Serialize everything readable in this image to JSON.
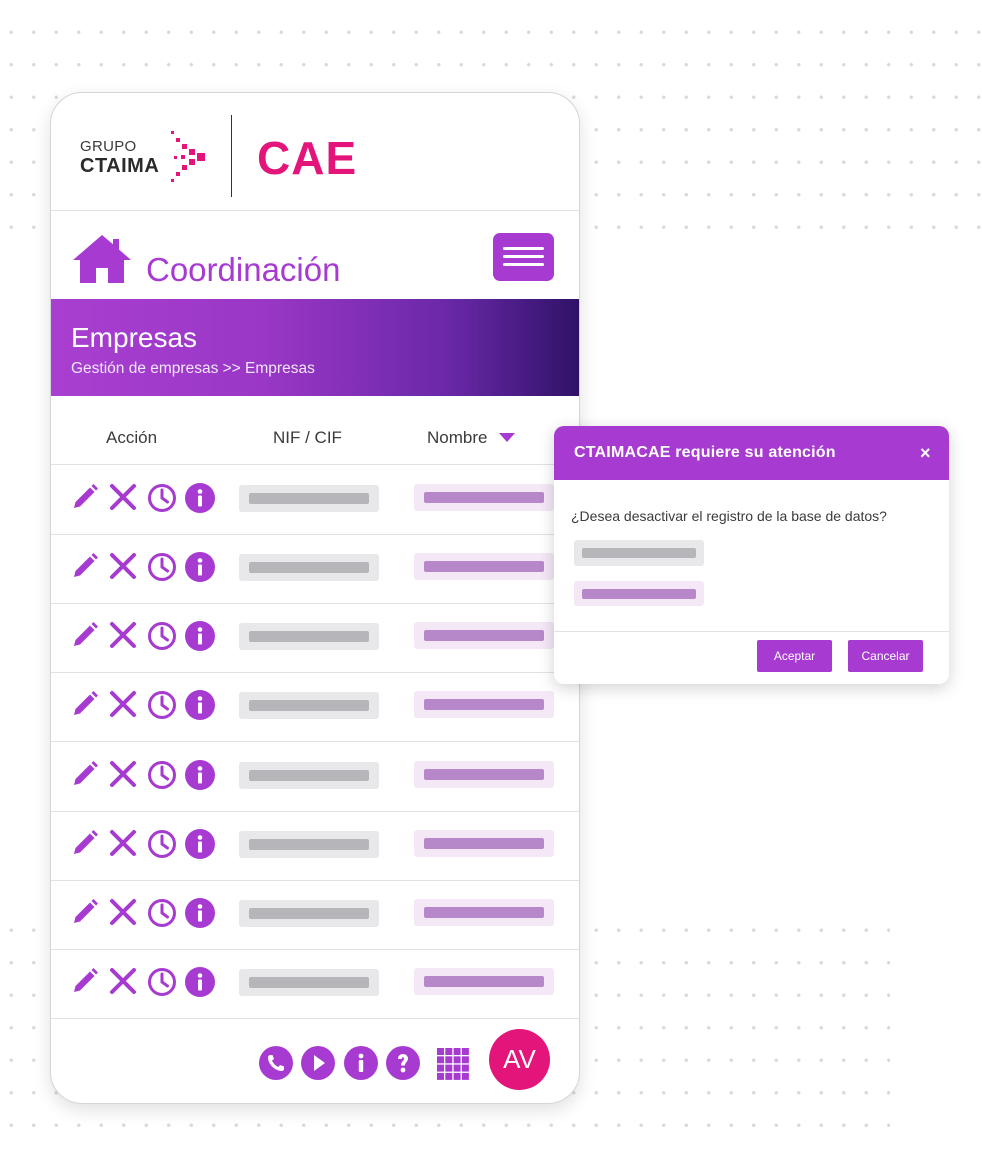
{
  "logo": {
    "group_line": "GRUPO",
    "brand_line": "CTAIMA",
    "product": "CAE"
  },
  "app": {
    "title": "Coordinación",
    "home_icon": "home-icon",
    "menu_icon": "hamburger-menu-icon"
  },
  "banner": {
    "title": "Empresas",
    "breadcrumb": "Gestión de empresas >> Empresas"
  },
  "table": {
    "columns": [
      "Acción",
      "NIF / CIF",
      "Nombre"
    ],
    "sort_icon": "caret-down-icon",
    "row_actions": [
      "pencil-icon",
      "close-icon",
      "clock-icon",
      "info-icon"
    ],
    "row_count": 8
  },
  "footer": {
    "icons": [
      "phone-icon",
      "play-icon",
      "info-icon",
      "help-icon",
      "apps-grid-icon"
    ],
    "avatar_initials": "AV"
  },
  "dialog": {
    "title": "CTAIMACAE requiere su atención",
    "close_label": "×",
    "message": "¿Desea desactivar el registro de la base de datos?",
    "accept_label": "Aceptar",
    "cancel_label": "Cancelar"
  },
  "colors": {
    "primary": "#a73bd1",
    "brand_pink": "#e3147a",
    "banner_end": "#2e1266",
    "placeholder_grey": "#b6b6ba",
    "placeholder_purple": "#b788c9"
  }
}
